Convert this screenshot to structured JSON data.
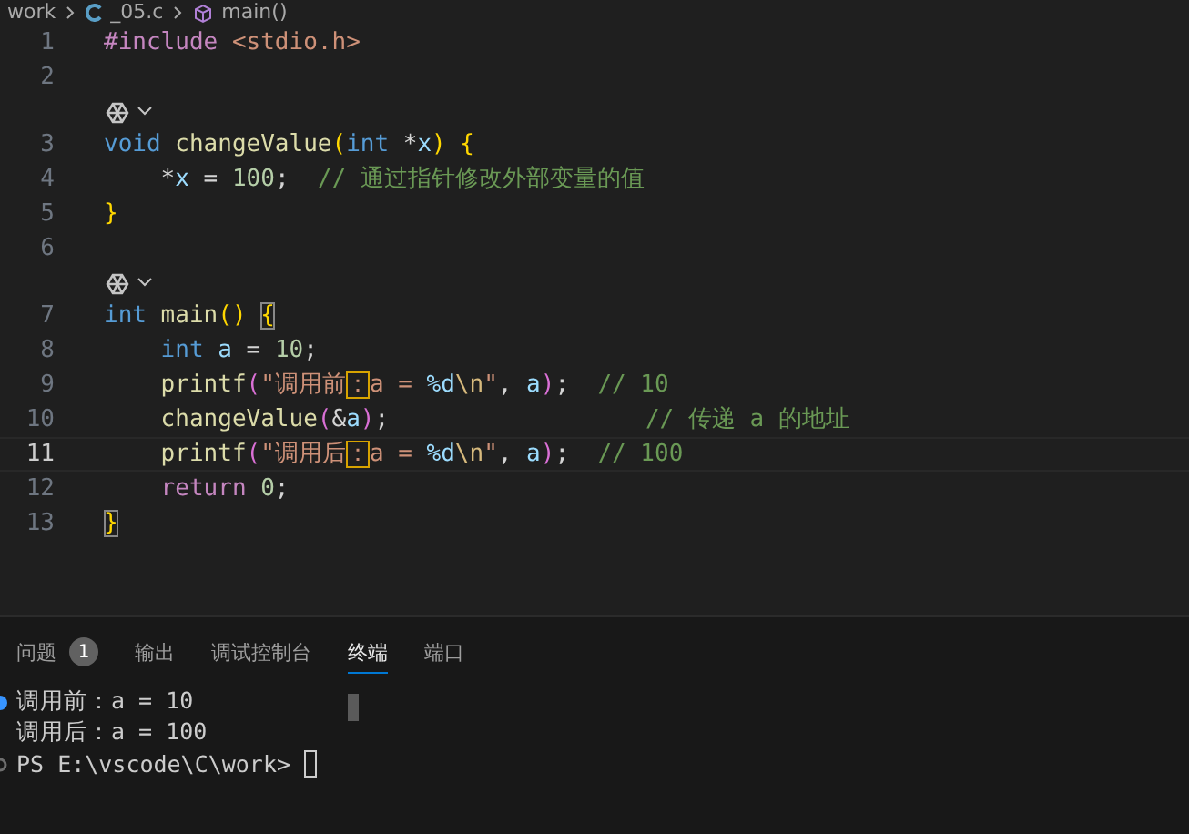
{
  "breadcrumb": [
    {
      "kind": "folder",
      "label": "work"
    },
    {
      "kind": "file",
      "label": "_05.c"
    },
    {
      "kind": "symbol",
      "label": "main()"
    }
  ],
  "editor": {
    "lines": [
      {
        "kind": "code",
        "number": "1",
        "current": false,
        "tokens": [
          {
            "text": "#include",
            "kind": "control"
          },
          {
            "text": " <stdio.h>",
            "kind": "string"
          }
        ]
      },
      {
        "kind": "code",
        "number": "2",
        "current": false
      },
      {
        "kind": "codelens"
      },
      {
        "kind": "code",
        "number": "3",
        "current": false,
        "tokens": [
          {
            "text": "void",
            "kind": "keyword"
          },
          {
            "text": " changeValue",
            "kind": "function"
          },
          {
            "text": "(",
            "kind": "bracket1"
          },
          {
            "text": "int",
            "kind": "keyword"
          },
          {
            "text": " *",
            "kind": "plain"
          },
          {
            "text": "x",
            "kind": "variable"
          },
          {
            "text": ") {",
            "kind": "bracket1"
          }
        ]
      },
      {
        "kind": "code",
        "number": "4",
        "current": false,
        "tokens": [
          {
            "text": "    *",
            "kind": "plain"
          },
          {
            "text": "x",
            "kind": "variable"
          },
          {
            "text": " = ",
            "kind": "plain"
          },
          {
            "text": "100",
            "kind": "number"
          },
          {
            "text": ";  ",
            "kind": "plain"
          },
          {
            "text": "// 通过指针修改外部变量的值",
            "kind": "comment"
          }
        ]
      },
      {
        "kind": "code",
        "number": "5",
        "current": false,
        "tokens": [
          {
            "text": "}",
            "kind": "bracket1"
          }
        ]
      },
      {
        "kind": "code",
        "number": "6",
        "current": false
      },
      {
        "kind": "codelens"
      },
      {
        "kind": "code",
        "number": "7",
        "current": false,
        "tokens": [
          {
            "text": "int",
            "kind": "keyword"
          },
          {
            "text": " main",
            "kind": "function"
          },
          {
            "text": "() ",
            "kind": "bracket1"
          },
          {
            "text": "{",
            "kind": "matched"
          }
        ]
      },
      {
        "kind": "code",
        "number": "8",
        "current": false,
        "tokens": [
          {
            "text": "    int",
            "kind": "keyword"
          },
          {
            "text": " a",
            "kind": "variable"
          },
          {
            "text": " = ",
            "kind": "plain"
          },
          {
            "text": "10",
            "kind": "number"
          },
          {
            "text": ";",
            "kind": "plain"
          }
        ]
      },
      {
        "kind": "code",
        "number": "9",
        "current": false,
        "tokens": [
          {
            "text": "    printf",
            "kind": "function"
          },
          {
            "text": "(",
            "kind": "bracket2"
          },
          {
            "text": "\"调用前",
            "kind": "string"
          },
          {
            "text": "：",
            "kind": "highlight"
          },
          {
            "text": "a = ",
            "kind": "string"
          },
          {
            "text": "%d",
            "kind": "format"
          },
          {
            "text": "\\n",
            "kind": "escape"
          },
          {
            "text": "\"",
            "kind": "string"
          },
          {
            "text": ", ",
            "kind": "plain"
          },
          {
            "text": "a",
            "kind": "variable"
          },
          {
            "text": ")",
            "kind": "bracket2"
          },
          {
            "text": ";  ",
            "kind": "plain"
          },
          {
            "text": "// 10",
            "kind": "comment"
          }
        ]
      },
      {
        "kind": "code",
        "number": "10",
        "current": false,
        "tokens": [
          {
            "text": "    changeValue",
            "kind": "function"
          },
          {
            "text": "(",
            "kind": "bracket2"
          },
          {
            "text": "&",
            "kind": "plain"
          },
          {
            "text": "a",
            "kind": "variable"
          },
          {
            "text": ")",
            "kind": "bracket2"
          },
          {
            "text": ";                  ",
            "kind": "plain"
          },
          {
            "text": "// 传递 a 的地址",
            "kind": "comment"
          }
        ]
      },
      {
        "kind": "code",
        "number": "11",
        "current": true,
        "tokens": [
          {
            "text": "    printf",
            "kind": "function"
          },
          {
            "text": "(",
            "kind": "bracket2"
          },
          {
            "text": "\"调用后",
            "kind": "string"
          },
          {
            "text": "：",
            "kind": "highlight"
          },
          {
            "text": "a = ",
            "kind": "string"
          },
          {
            "text": "%d",
            "kind": "format"
          },
          {
            "text": "\\n",
            "kind": "escape"
          },
          {
            "text": "\"",
            "kind": "string"
          },
          {
            "text": ", ",
            "kind": "plain"
          },
          {
            "text": "a",
            "kind": "variable"
          },
          {
            "text": ")",
            "kind": "bracket2"
          },
          {
            "text": ";  ",
            "kind": "plain"
          },
          {
            "text": "// 100",
            "kind": "comment"
          }
        ]
      },
      {
        "kind": "code",
        "number": "12",
        "current": false,
        "tokens": [
          {
            "text": "    return ",
            "kind": "control"
          },
          {
            "text": "0",
            "kind": "number"
          },
          {
            "text": ";",
            "kind": "plain"
          }
        ]
      },
      {
        "kind": "code",
        "number": "13",
        "current": false,
        "tokens": [
          {
            "text": "}",
            "kind": "matched"
          }
        ]
      }
    ]
  },
  "panel": {
    "tabs": [
      {
        "label": "问题",
        "badge": "1",
        "selected": false
      },
      {
        "label": "输出",
        "selected": false
      },
      {
        "label": "调试控制台",
        "selected": false
      },
      {
        "label": "终端",
        "selected": true
      },
      {
        "label": "端口",
        "selected": false
      }
    ],
    "terminal": [
      {
        "text": "调用前：a = 10",
        "kind": "success",
        "cursor": false
      },
      {
        "text": "调用后：a = 100",
        "kind": "plain",
        "cursor": false
      },
      {
        "text": "PS E:\\vscode\\C\\work>",
        "kind": "prompt",
        "cursor": true
      }
    ]
  }
}
